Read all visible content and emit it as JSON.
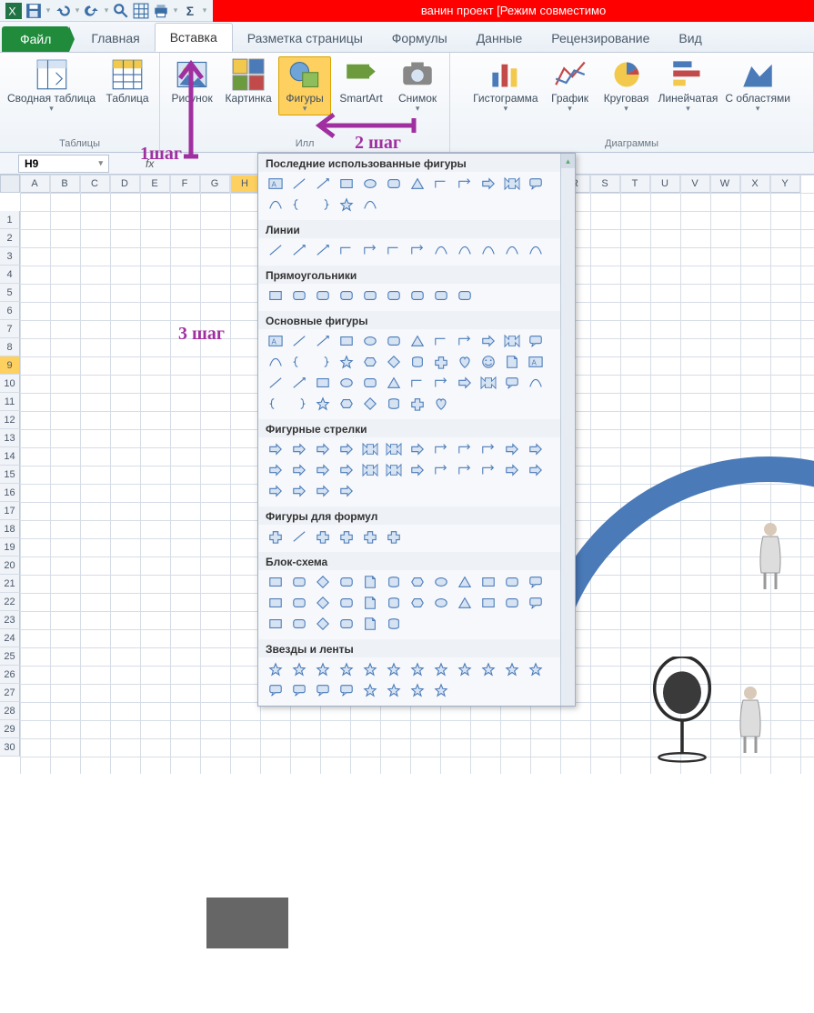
{
  "title": "ванин проект  [Режим совместимо",
  "tabs": {
    "file": "Файл",
    "home": "Главная",
    "insert": "Вставка",
    "layout": "Разметка страницы",
    "formulas": "Формулы",
    "data": "Данные",
    "review": "Рецензирование",
    "view": "Вид"
  },
  "ribbon": {
    "tables_group": "Таблицы",
    "pivot": "Сводная таблица",
    "table": "Таблица",
    "illus_group": "Илл",
    "picture": "Рисунок",
    "clipart": "Картинка",
    "shapes": "Фигуры",
    "smartart": "SmartArt",
    "screenshot": "Снимок",
    "charts_group": "Диаграммы",
    "hist": "Гистограмма",
    "line": "График",
    "pie": "Круговая",
    "bar": "Линейчатая",
    "area": "С областями"
  },
  "namebox": "H9",
  "columns": [
    "A",
    "B",
    "C",
    "D",
    "E",
    "F",
    "G",
    "H",
    "",
    "",
    "",
    "",
    "",
    "",
    "",
    "",
    "",
    "",
    "R",
    "S",
    "T",
    "U",
    "V",
    "W",
    "X",
    "Y"
  ],
  "rows": [
    1,
    2,
    3,
    4,
    5,
    6,
    7,
    8,
    9,
    10,
    11,
    12,
    13,
    14,
    15,
    16,
    17,
    18,
    19,
    20,
    21,
    22,
    23,
    24,
    25,
    26,
    27,
    28,
    29,
    30
  ],
  "annotations": {
    "step1": "1шаг",
    "step2": "2 шаг",
    "step3": "3 шаг"
  },
  "shapes_panel": {
    "recent": "Последние использованные фигуры",
    "lines": "Линии",
    "rects": "Прямоугольники",
    "basic": "Основные фигуры",
    "arrows": "Фигурные стрелки",
    "formula": "Фигуры для формул",
    "flow": "Блок-схема",
    "stars": "Звезды и ленты"
  }
}
